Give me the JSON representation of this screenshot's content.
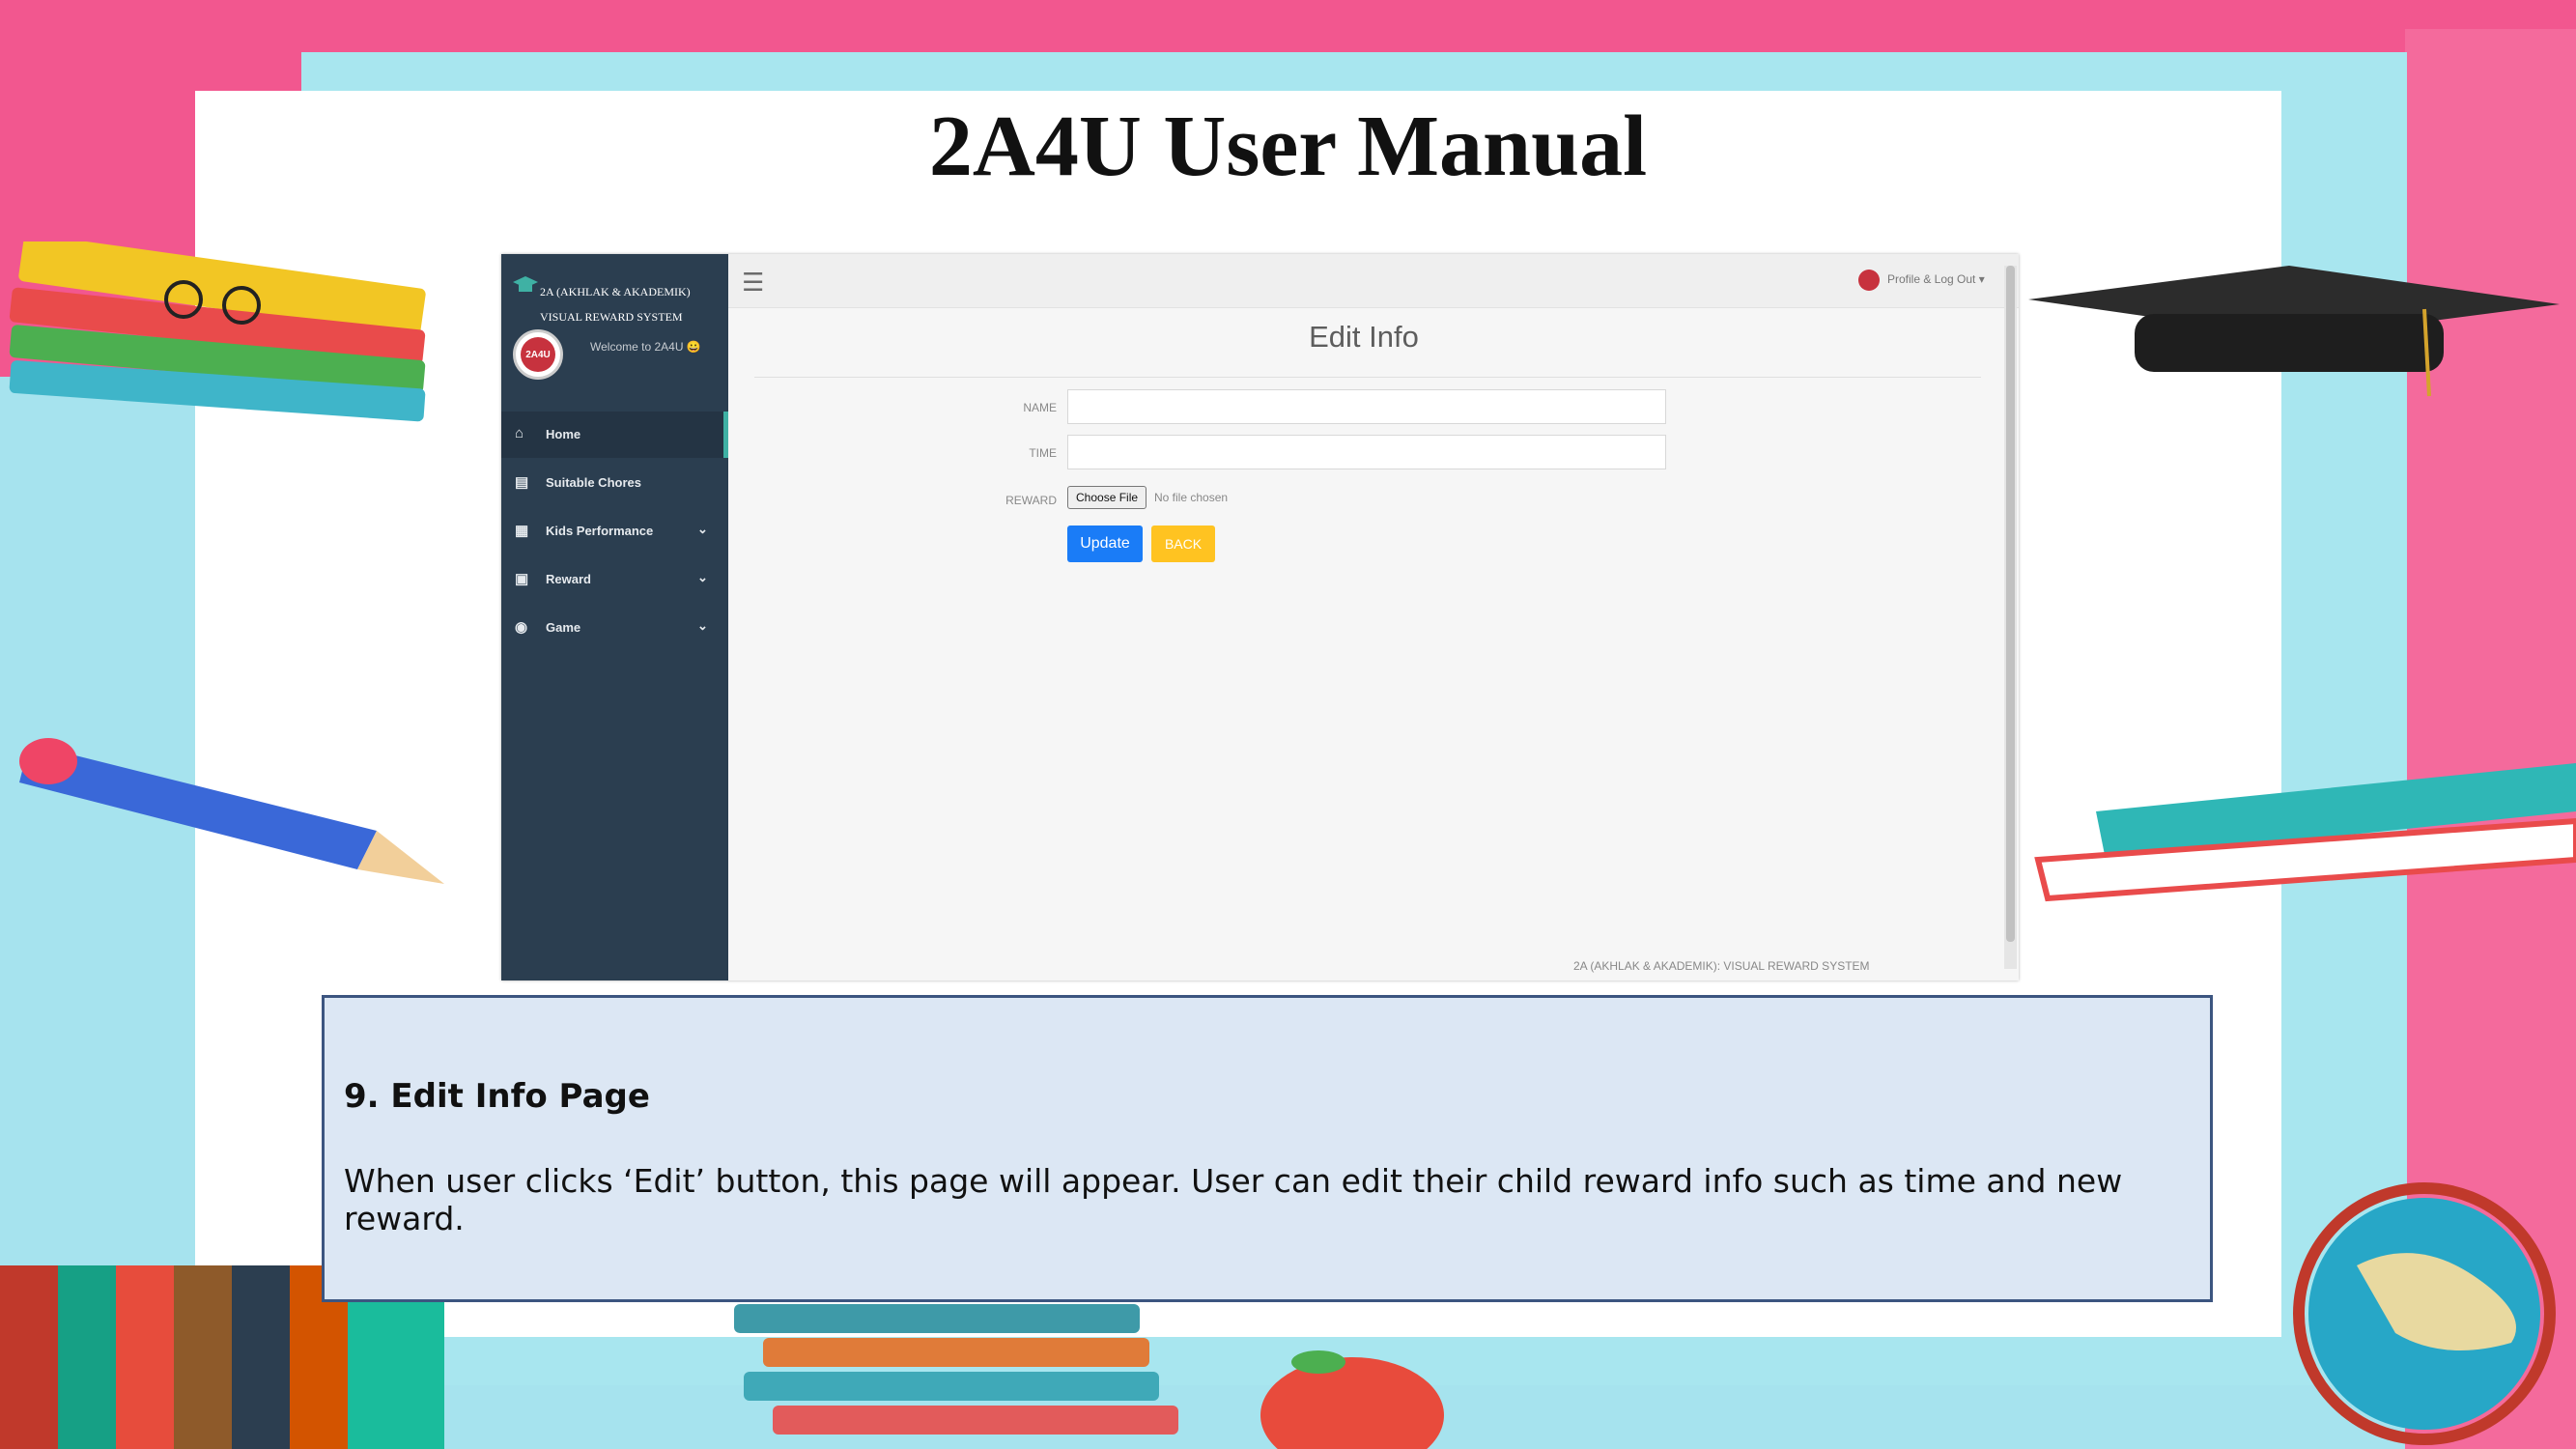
{
  "slide": {
    "title": "2A4U User Manual",
    "caption_heading": "9. Edit  Info Page",
    "caption_body": "When user clicks ‘Edit’ button, this page will appear. User can edit their child reward info such as time and new reward."
  },
  "app": {
    "brand_line1": "2A (AKHLAK & AKADEMIK)",
    "brand_line2": "VISUAL REWARD SYSTEM",
    "avatar_text": "2A4U",
    "welcome": "Welcome to 2A4U 😀",
    "profile_menu": "Profile & Log Out ▾",
    "sidebar": [
      {
        "label": "Home",
        "icon": "home-icon",
        "active": true
      },
      {
        "label": "Suitable Chores",
        "icon": "chores-icon"
      },
      {
        "label": "Kids Performance",
        "icon": "calendar-icon",
        "expandable": true
      },
      {
        "label": "Reward",
        "icon": "gift-icon",
        "expandable": true
      },
      {
        "label": "Game",
        "icon": "gamepad-icon",
        "expandable": true
      }
    ],
    "page_title": "Edit Info",
    "form": {
      "name_label": "NAME",
      "time_label": "TIME",
      "reward_label": "REWARD",
      "name_value": "",
      "time_value": "",
      "choose_file": "Choose File",
      "no_file": "No file chosen",
      "update": "Update",
      "back": "BACK"
    },
    "footer": "2A (AKHLAK & AKADEMIK): VISUAL REWARD SYSTEM"
  },
  "colors": {
    "sidebar_bg": "#2b3e50",
    "update_button": "#1a7cf7",
    "back_button": "#ffc321",
    "caption_bg": "#dce7f4",
    "frame_pink": "#f2578f",
    "frame_cyan": "#a6e3ee"
  }
}
